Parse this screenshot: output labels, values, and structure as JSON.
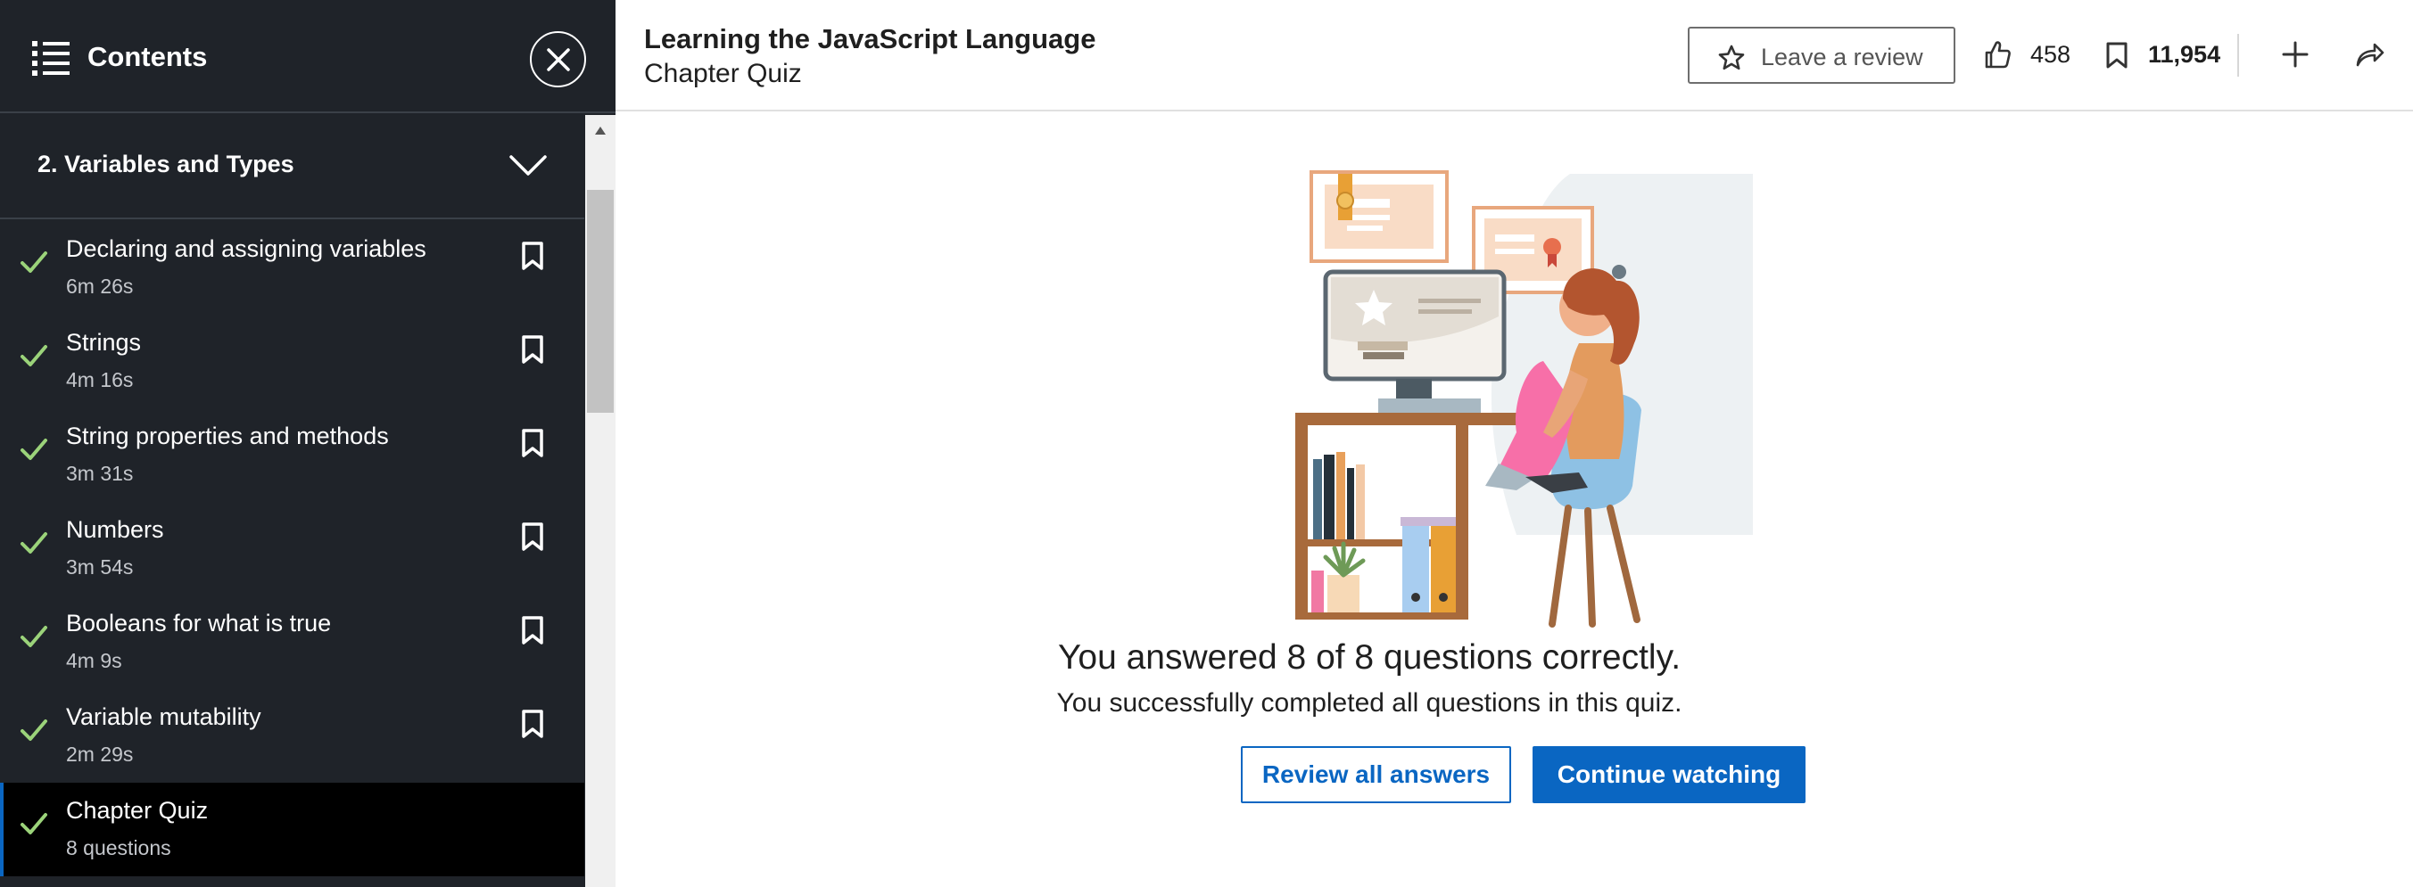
{
  "sidebar": {
    "title": "Contents",
    "section": {
      "title": "2. Variables and Types"
    },
    "items": [
      {
        "label": "Declaring and assigning variables",
        "meta": "6m 26s",
        "completed": true,
        "bookmarkable": true,
        "active": false
      },
      {
        "label": "Strings",
        "meta": "4m 16s",
        "completed": true,
        "bookmarkable": true,
        "active": false
      },
      {
        "label": "String properties and methods",
        "meta": "3m 31s",
        "completed": true,
        "bookmarkable": true,
        "active": false
      },
      {
        "label": "Numbers",
        "meta": "3m 54s",
        "completed": true,
        "bookmarkable": true,
        "active": false
      },
      {
        "label": "Booleans for what is true",
        "meta": "4m 9s",
        "completed": true,
        "bookmarkable": true,
        "active": false
      },
      {
        "label": "Variable mutability",
        "meta": "2m 29s",
        "completed": true,
        "bookmarkable": true,
        "active": false
      },
      {
        "label": "Chapter Quiz",
        "meta": "8 questions",
        "completed": true,
        "bookmarkable": false,
        "active": true
      }
    ]
  },
  "header": {
    "course_title": "Learning the JavaScript Language",
    "subtitle": "Chapter Quiz",
    "review_label": "Leave a review",
    "likes": "458",
    "saves": "11,954"
  },
  "main": {
    "result_title": "You answered 8 of 8 questions correctly.",
    "result_subtitle": "You successfully completed all questions in this quiz.",
    "review_button": "Review all answers",
    "continue_button": "Continue watching"
  },
  "colors": {
    "sidebar_bg": "#1f2329",
    "active_item_bg": "#000000",
    "check": "#9bd37a",
    "accent": "#0a66c2"
  },
  "icons": {
    "menu": "list-icon",
    "close": "close-icon",
    "chevron": "chevron-down-icon",
    "check": "check-icon",
    "bookmark": "bookmark-icon",
    "star": "star-icon",
    "like": "thumbs-up-icon",
    "plus": "plus-icon",
    "share": "share-icon"
  }
}
